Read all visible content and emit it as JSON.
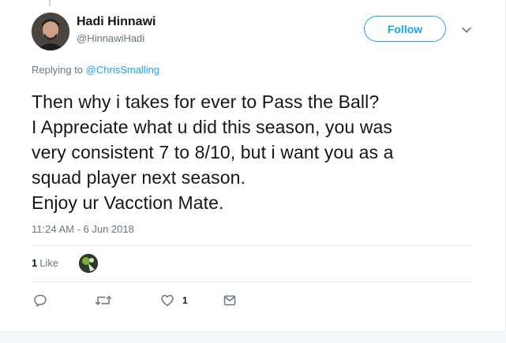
{
  "author": {
    "display_name": "Hadi Hinnawi",
    "handle": "@HinnawiHadi"
  },
  "follow_label": "Follow",
  "reply": {
    "prefix": "Replying to",
    "mention": "@ChrisSmalling"
  },
  "tweet": {
    "lines": [
      "Then why i takes for ever to Pass the Ball?",
      "I Appreciate what u did this season, you was",
      "very consistent 7 to 8/10, but i want you as a",
      "squad player next season.",
      "Enjoy ur Vacction Mate."
    ],
    "timestamp": "11:24 AM - 6 Jun 2018"
  },
  "stats": {
    "like_count": "1",
    "like_label": "Like"
  },
  "actions": {
    "like_count": "1"
  },
  "icons": {
    "caret": "chevron-down-icon",
    "reply": "reply-icon",
    "retweet": "retweet-icon",
    "like": "heart-icon",
    "dm": "envelope-icon"
  },
  "colors": {
    "accent": "#1da1f2",
    "secondary_text": "#657786",
    "primary_text": "#14171a",
    "divider": "#e6ecf0"
  }
}
